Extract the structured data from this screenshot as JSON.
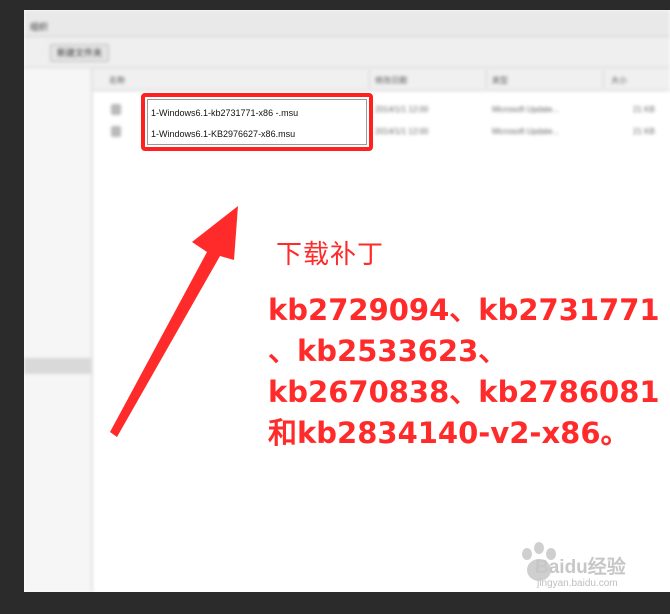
{
  "explorer": {
    "menu_label": "组织",
    "toolbar_button": "新建文件夹",
    "columns": [
      "名称",
      "修改日期",
      "类型",
      "大小"
    ],
    "rows": [
      {
        "date": "2014/1/1 12:00",
        "type": "Microsoft Update...",
        "size": "21 KB"
      },
      {
        "date": "2014/1/1 12:00",
        "type": "Microsoft Update...",
        "size": "21 KB"
      }
    ]
  },
  "files": [
    "1-Windows6.1-kb2731771-x86 -.msu",
    "1-Windows6.1-KB2976627-x86.msu"
  ],
  "annotation": {
    "heading": "下载补丁",
    "lines": [
      "kb2729094、kb2731771",
      "、kb2533623、",
      "kb2670838、kb2786081",
      "和kb2834140-v2-x86。"
    ]
  },
  "watermark": {
    "brand": "Baidu经验",
    "url": "jingyan.baidu.com"
  },
  "colors": {
    "annotation_red": "#ff2a2a",
    "highlight_box": "#ff2020",
    "background": "#2b2b2b"
  },
  "icons": [
    "arrow-icon",
    "file-icon",
    "baidu-paw-icon"
  ]
}
